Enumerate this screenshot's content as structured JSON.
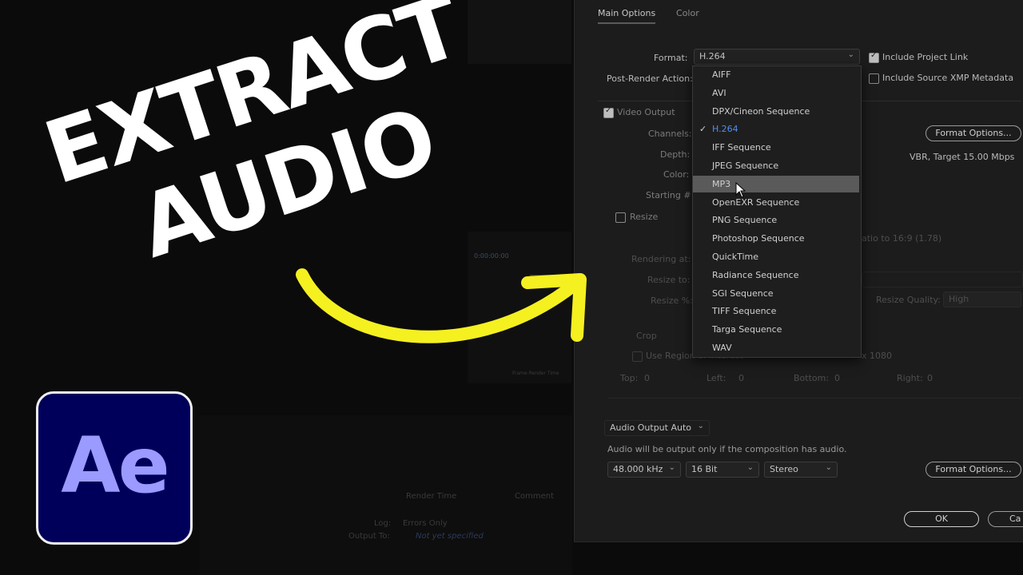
{
  "thumbnail": {
    "headline_line1": "EXTRACT",
    "headline_line2": "AUDIO",
    "logo_text": "Ae"
  },
  "background_panel": {
    "timecode": "0:00:00:00",
    "frame_render_time": "Frame Render Time",
    "render_time_col": "Render Time",
    "comment_col": "Comment",
    "log_label": "Log:",
    "log_value": "Errors Only",
    "output_to_label": "Output To:",
    "output_to_value": "Not yet specified"
  },
  "dialog": {
    "tabs": [
      "Main Options",
      "Color"
    ],
    "format_label": "Format:",
    "format_value": "H.264",
    "post_render_label": "Post-Render Action:",
    "include_project_link": "Include Project Link",
    "include_xmp": "Include Source XMP Metadata",
    "video_output": "Video Output",
    "channels_label": "Channels:",
    "depth_label": "Depth:",
    "color_label": "Color:",
    "starting_label": "Starting #:",
    "format_options_btn": "Format Options...",
    "vbr_text": "VBR, Target 15.00 Mbps",
    "resize": "Resize",
    "rendering_at": "Rendering at:",
    "resize_to": "Resize to:",
    "resize_pct": "Resize %:",
    "aspect_text": "atio to 16:9 (1.78)",
    "resize_quality_label": "Resize Quality:",
    "resize_quality_value": "High",
    "crop": "Crop",
    "use_region": "Use Region of Interest",
    "size_text": "x 1080",
    "top": "Top:",
    "top_val": "0",
    "left": "Left:",
    "left_val": "0",
    "bottom": "Bottom:",
    "bottom_val": "0",
    "right": "Right:",
    "right_val": "0",
    "audio_output": "Audio Output Auto",
    "audio_note": "Audio will be output only if the composition has audio.",
    "sample_rate": "48.000 kHz",
    "bit_depth": "16 Bit",
    "channels_audio": "Stereo",
    "audio_format_options_btn": "Format Options...",
    "ok": "OK",
    "cancel": "Ca"
  },
  "format_menu": {
    "items": [
      "AIFF",
      "AVI",
      "DPX/Cineon Sequence",
      "H.264",
      "IFF Sequence",
      "JPEG Sequence",
      "MP3",
      "OpenEXR Sequence",
      "PNG Sequence",
      "Photoshop Sequence",
      "QuickTime",
      "Radiance Sequence",
      "SGI Sequence",
      "TIFF Sequence",
      "Targa Sequence",
      "WAV"
    ],
    "checked": "H.264",
    "highlighted": "MP3"
  },
  "colors": {
    "arrow": "#f5f020",
    "logo_bg": "#00005a",
    "logo_text": "#9a9aff",
    "accent_blue": "#4f8ff0"
  }
}
